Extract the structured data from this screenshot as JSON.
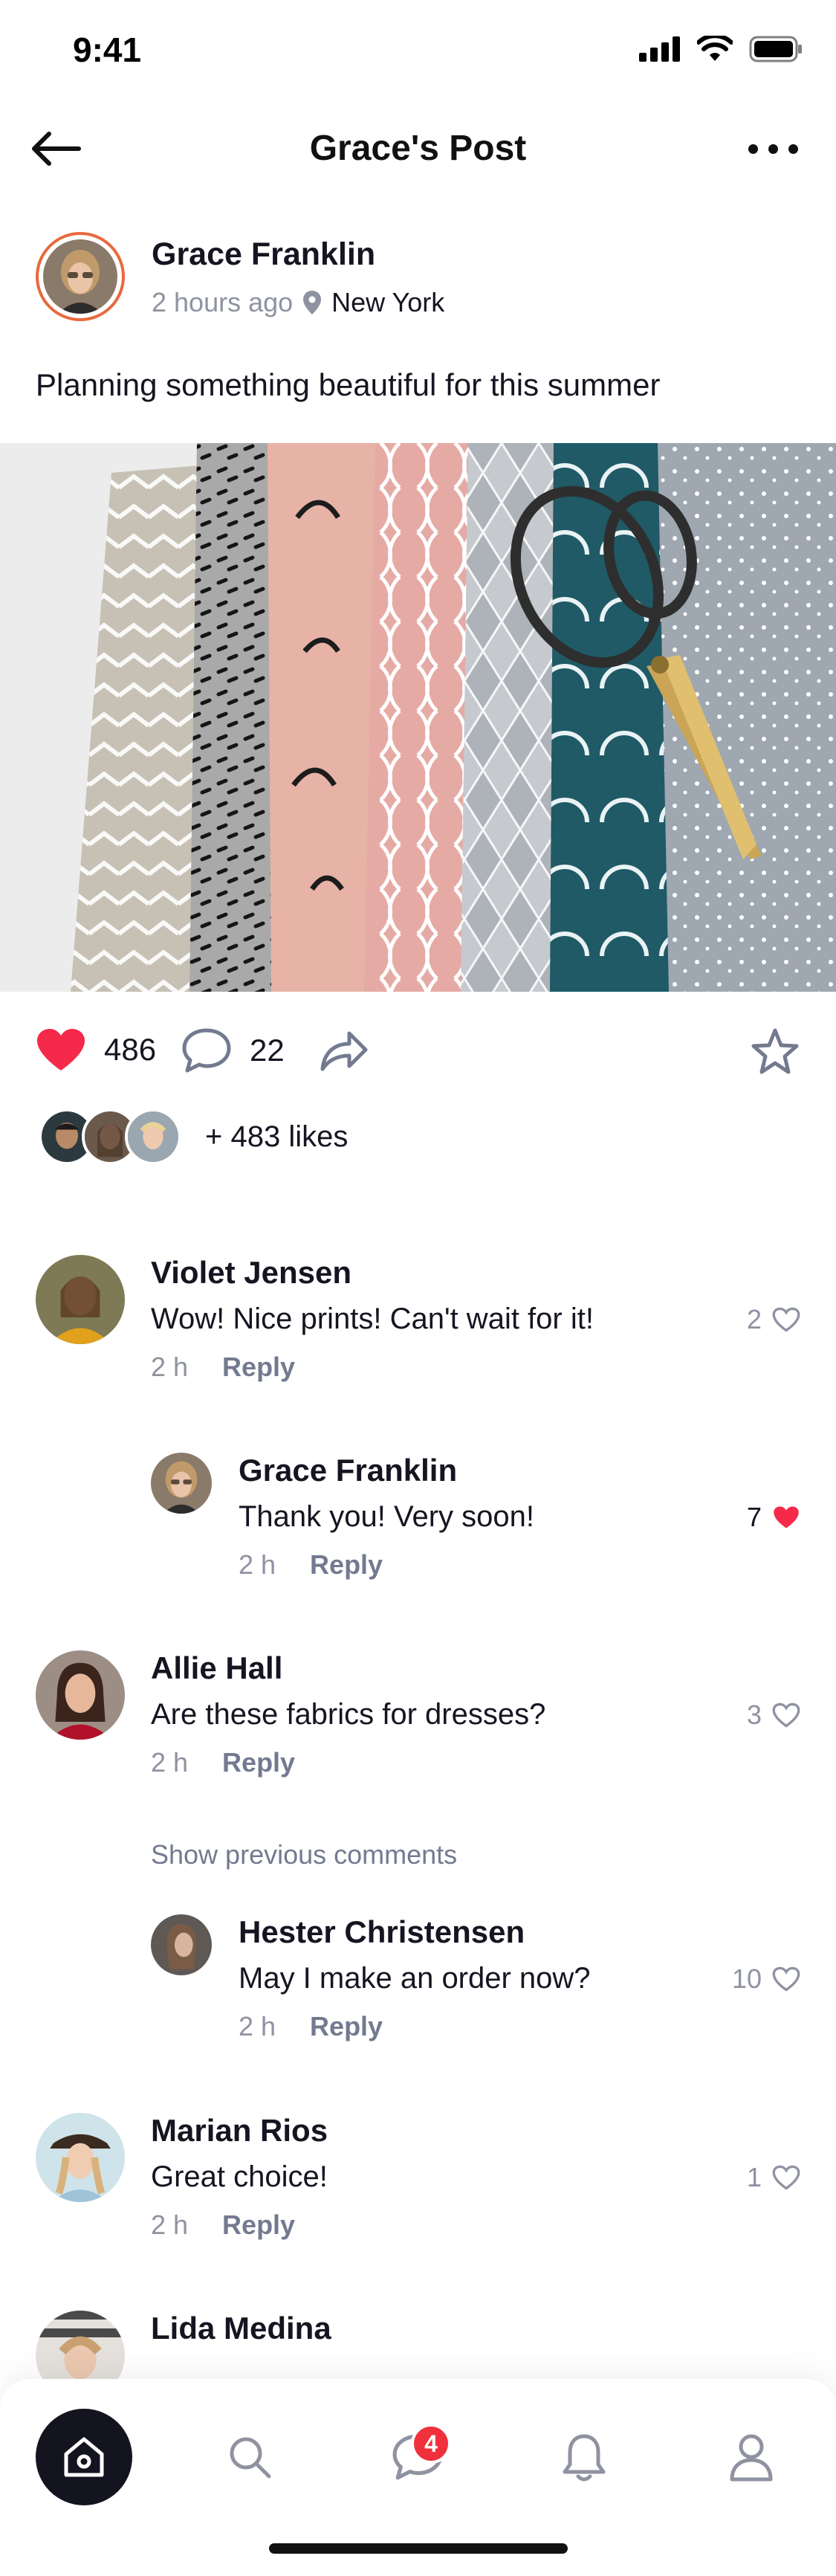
{
  "status": {
    "time": "9:41"
  },
  "header": {
    "title": "Grace's Post"
  },
  "post": {
    "author": "Grace Franklin",
    "time": "2 hours ago",
    "location": "New York",
    "caption": "Planning something beautiful for this summer",
    "likes_count": "486",
    "comments_count": "22",
    "likes_summary": "+ 483 likes"
  },
  "comments": [
    {
      "name": "Violet Jensen",
      "text": "Wow! Nice prints! Can't wait for it!",
      "time": "2 h",
      "reply": "Reply",
      "likes": "2",
      "liked": false
    },
    {
      "name": "Grace Franklin",
      "text": "Thank you! Very soon!",
      "time": "2 h",
      "reply": "Reply",
      "likes": "7",
      "liked": true
    },
    {
      "name": "Allie Hall",
      "text": "Are these fabrics for dresses?",
      "time": "2 h",
      "reply": "Reply",
      "likes": "3",
      "liked": false
    },
    {
      "name": "Hester Christensen",
      "text": "May I make an order now?",
      "time": "2 h",
      "reply": "Reply",
      "likes": "10",
      "liked": false
    },
    {
      "name": "Marian Rios",
      "text": "Great choice!",
      "time": "2 h",
      "reply": "Reply",
      "likes": "1",
      "liked": false
    },
    {
      "name": "Lida Medina"
    }
  ],
  "show_previous": "Show previous comments",
  "tabbar": {
    "messages_badge": "4"
  },
  "colors": {
    "accent": "#f5294a",
    "dark": "#141421",
    "muted": "#8f92a1",
    "ring": "#e8693d",
    "badge": "#f0303c"
  },
  "icons": [
    "back-arrow-icon",
    "more-icon",
    "location-pin-icon",
    "heart-icon",
    "comment-icon",
    "share-icon",
    "star-icon",
    "home-icon",
    "search-icon",
    "chat-icon",
    "bell-icon",
    "profile-icon"
  ]
}
